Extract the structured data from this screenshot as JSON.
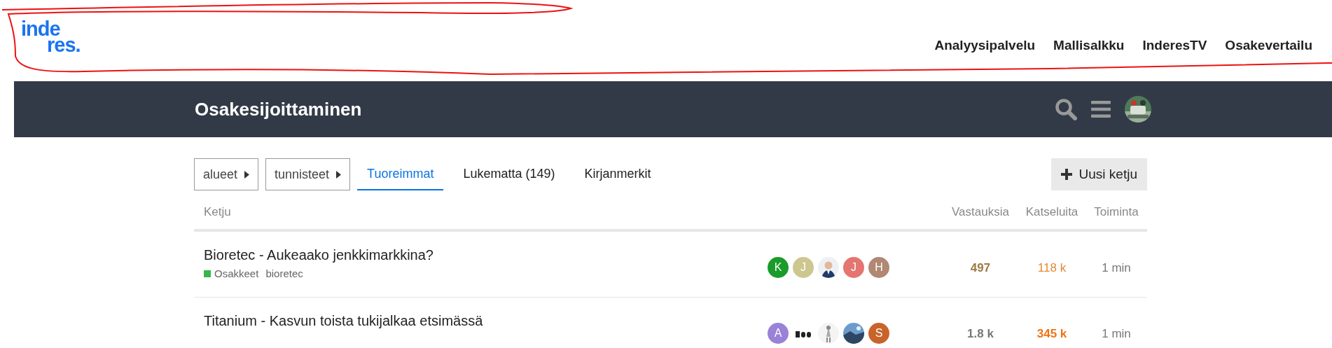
{
  "logo": {
    "lines": [
      "inde",
      "res."
    ]
  },
  "site_nav": {
    "links": [
      "Analyysipalvelu",
      "Mallisalkku",
      "InderesTV",
      "Osakevertailu"
    ]
  },
  "header": {
    "title": "Osakesijoittaminen"
  },
  "filters": {
    "dropdowns": [
      "alueet",
      "tunnisteet"
    ],
    "tabs": [
      {
        "label": "Tuoreimmat",
        "selected": true
      },
      {
        "label": "Lukematta (149)",
        "selected": false
      },
      {
        "label": "Kirjanmerkit",
        "selected": false
      }
    ],
    "new_button": "Uusi ketju"
  },
  "table": {
    "columns": [
      "Ketju",
      "Vastauksia",
      "Katseluita",
      "Toiminta"
    ],
    "rows": [
      {
        "title": "Bioretec - Aukeaako jenkkimarkkina?",
        "category": {
          "name": "Osakkeet",
          "color": "#3ab54a"
        },
        "tags": [
          "bioretec"
        ],
        "posters": [
          {
            "kind": "letter",
            "letter": "K",
            "color": "#1a9b2a"
          },
          {
            "kind": "letter",
            "letter": "J",
            "color": "#cdc78f"
          },
          {
            "kind": "picture"
          },
          {
            "kind": "letter",
            "letter": "J",
            "color": "#e47570"
          },
          {
            "kind": "letter",
            "letter": "H",
            "color": "#b08874"
          }
        ],
        "replies": {
          "text": "497",
          "color": "#9b7a45"
        },
        "views": {
          "text": "118 k",
          "color": "#e38a33"
        },
        "activity": "1 min"
      },
      {
        "title": "Titanium - Kasvun toista tukijalkaa etsimässä",
        "posters": [
          {
            "kind": "letter",
            "letter": "A",
            "color": "#9a82d6"
          },
          {
            "kind": "picture"
          },
          {
            "kind": "picture"
          },
          {
            "kind": "picture"
          },
          {
            "kind": "letter",
            "letter": "S",
            "color": "#c8642a"
          }
        ],
        "replies": {
          "text": "1.8 k",
          "color": "#777777"
        },
        "views": {
          "text": "345 k",
          "color": "#f07214"
        },
        "activity": "1 min"
      }
    ]
  }
}
